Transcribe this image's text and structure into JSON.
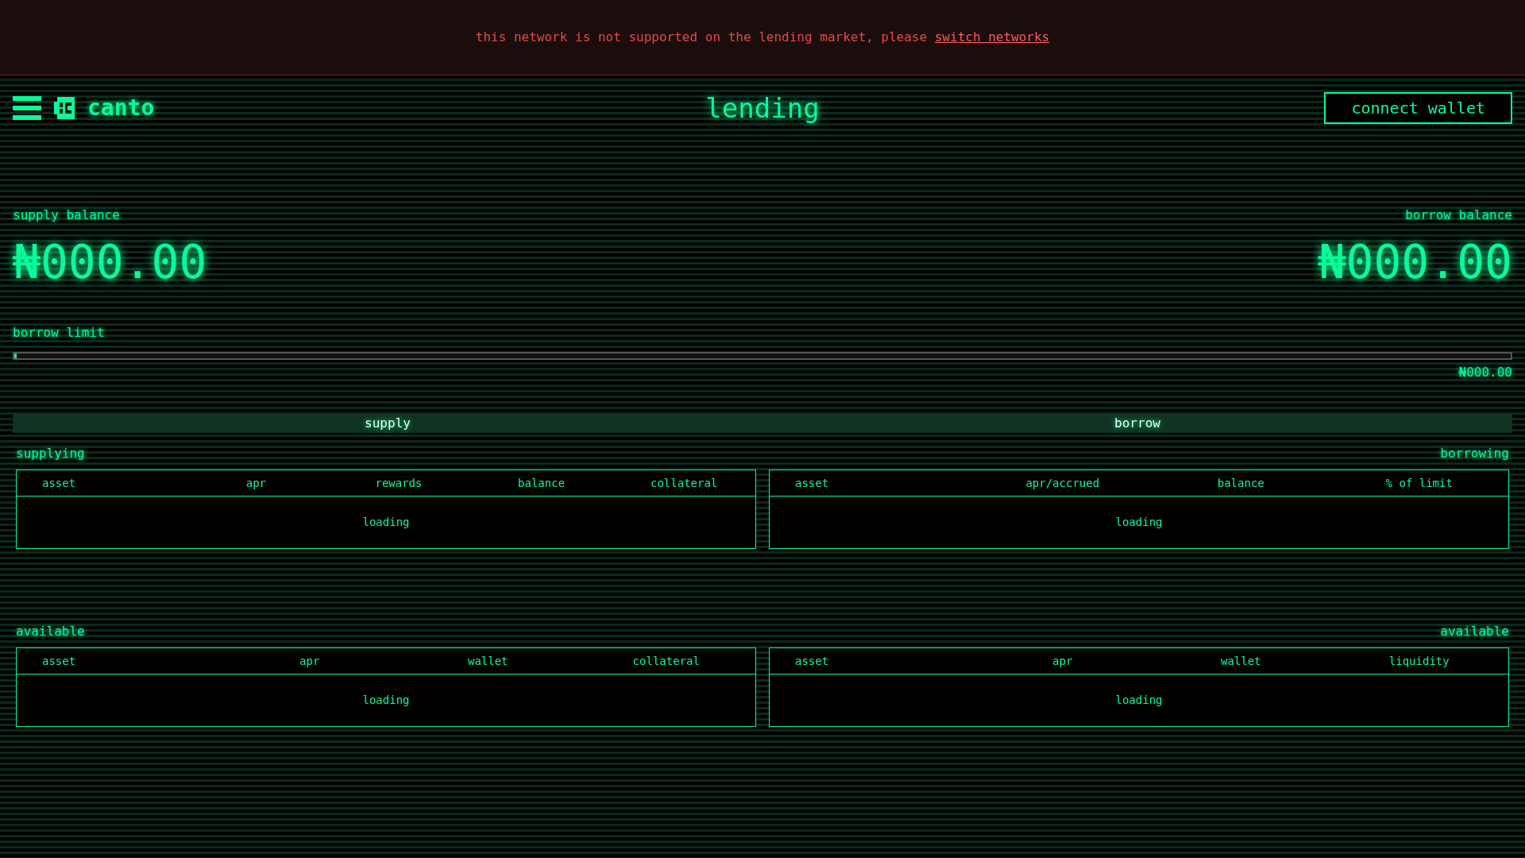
{
  "banner": {
    "message": "this network is not supported on the lending market, please ",
    "link": "switch networks"
  },
  "header": {
    "logo_text": "canto",
    "title": "lending",
    "connect_button": "connect wallet"
  },
  "balances": [
    {
      "label": "supply balance",
      "value": "₦000.00"
    },
    {
      "label": "borrow balance",
      "value": "₦000.00"
    }
  ],
  "borrow_limit": {
    "label": "borrow limit",
    "level": 0,
    "value": "₦000.00"
  },
  "tabs": [
    {
      "label": "supply",
      "selected": true
    },
    {
      "label": "borrow",
      "selected": true
    }
  ],
  "sections": [
    {
      "title": "supplying",
      "columns": [
        "asset",
        "apr",
        "rewards",
        "balance",
        "collateral"
      ],
      "status": "loading"
    },
    {
      "title": "borrowing",
      "columns": [
        "asset",
        "apr/accrued",
        "balance",
        "% of limit"
      ],
      "status": "loading"
    },
    {
      "title": "available",
      "columns": [
        "asset",
        "apr",
        "wallet",
        "collateral"
      ],
      "status": "loading"
    },
    {
      "title": "available",
      "columns": [
        "asset",
        "apr",
        "wallet",
        "liquidity"
      ],
      "status": "loading"
    }
  ]
}
